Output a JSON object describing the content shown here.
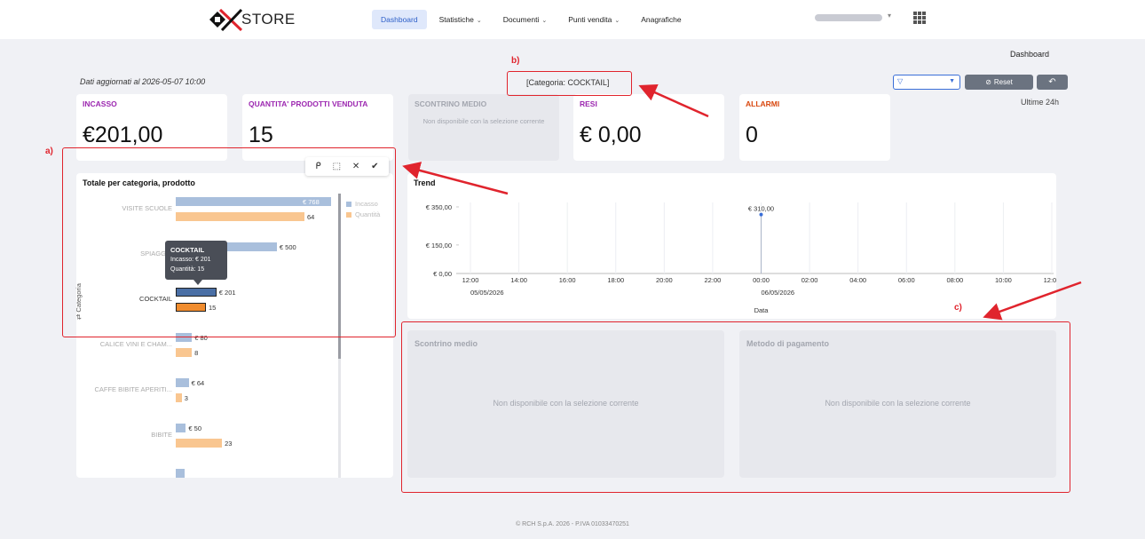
{
  "brand": {
    "logo_text": "STORE"
  },
  "nav": {
    "items": [
      {
        "label": "Dashboard",
        "active": true,
        "dropdown": false
      },
      {
        "label": "Statistiche",
        "active": false,
        "dropdown": true
      },
      {
        "label": "Documenti",
        "active": false,
        "dropdown": true
      },
      {
        "label": "Punti vendita",
        "active": false,
        "dropdown": true
      },
      {
        "label": "Anagrafiche",
        "active": false,
        "dropdown": false
      }
    ]
  },
  "page": {
    "breadcrumb": "Dashboard",
    "updated": "Dati aggiornati al 2026-05-07 10:00",
    "active_filter": "[Categoria: COCKTAIL]",
    "reset_label": "Reset",
    "period": "Ultime 24h"
  },
  "kpis": {
    "incasso": {
      "label": "INCASSO",
      "value": "€201,00"
    },
    "quantita": {
      "label": "QUANTITA' PRODOTTI VENDUTA",
      "value": "15"
    },
    "scontrino": {
      "label": "SCONTRINO MEDIO",
      "note": "Non disponibile con la selezione corrente"
    },
    "resi": {
      "label": "RESI",
      "value": "€ 0,00"
    },
    "allarmi": {
      "label": "ALLARMI",
      "value": "0"
    }
  },
  "category_chart": {
    "title": "Totale per categoria, prodotto",
    "y_axis_title": "Categoria",
    "legend": [
      "Incasso",
      "Quantità"
    ],
    "colors": {
      "incasso": "#a9bfdc",
      "quantita": "#f9c690",
      "incasso_sel": "#4a6fa5",
      "quantita_sel": "#f08c2e"
    },
    "tooltip": {
      "title": "COCKTAIL",
      "incasso": "Incasso:  € 201",
      "quantita": "Quantità:    15"
    }
  },
  "chart_data": [
    {
      "type": "bar",
      "orientation": "horizontal",
      "title": "Totale per categoria, prodotto",
      "ylabel": "Categoria",
      "categories": [
        "VISITE SCUOLE",
        "SPIAGGIA",
        "COCKTAIL",
        "CALICE VINI E CHAM...",
        "CAFFE BIBITE APERITI...",
        "BIBITE"
      ],
      "series": [
        {
          "name": "Incasso",
          "values": [
            768,
            500,
            201,
            80,
            64,
            50
          ],
          "labels": [
            "€ 768",
            "€ 500",
            "€ 201",
            "€ 80",
            "€ 64",
            "€ 50"
          ]
        },
        {
          "name": "Quantità",
          "values": [
            64,
            null,
            15,
            8,
            3,
            23
          ],
          "labels": [
            "64",
            "",
            "15",
            "8",
            "3",
            "23"
          ]
        }
      ],
      "selected": "COCKTAIL",
      "legend_position": "top-right"
    },
    {
      "type": "line",
      "title": "Trend",
      "xlabel": "Data",
      "y_ticks": [
        "€ 350,00",
        "€ 150,00",
        "€ 0,00"
      ],
      "x_ticks": [
        "12:00",
        "14:00",
        "16:00",
        "18:00",
        "20:00",
        "22:00",
        "00:00",
        "02:00",
        "04:00",
        "06:00",
        "08:00",
        "10:00",
        "12:00"
      ],
      "date_labels": [
        "05/05/2026",
        "06/05/2026"
      ],
      "points": [
        {
          "x": "06/05/2026 00:00",
          "y": 310,
          "label": "€ 310,00"
        }
      ]
    }
  ],
  "panels": {
    "scontrino_medio": {
      "title": "Scontrino medio",
      "note": "Non disponibile con la selezione corrente"
    },
    "metodo_pagamento": {
      "title": "Metodo di pagamento",
      "note": "Non disponibile con la selezione corrente"
    }
  },
  "annotations": {
    "a": "a)",
    "b": "b)",
    "c": "c)",
    "color": "#e0242d"
  },
  "footer": "© RCH S.p.A. 2026 - P.IVA 01033470251"
}
